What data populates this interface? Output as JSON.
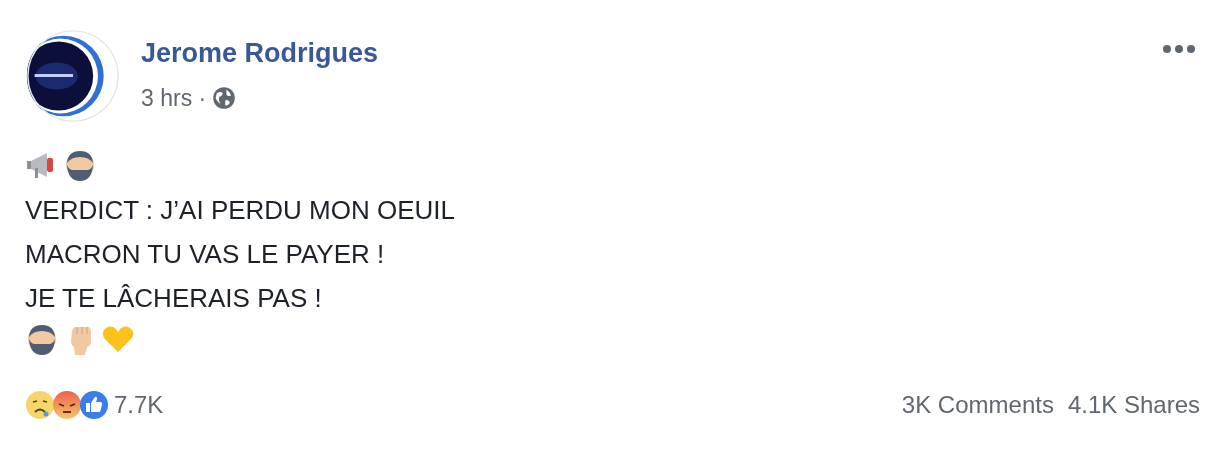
{
  "post": {
    "author": "Jerome Rodrigues",
    "time": "3 hrs ·",
    "lines": [
      "VERDICT : J’AI PERDU MON OEUIL",
      "MACRON TU VAS LE PAYER !",
      "JE TE LÂCHERAIS PAS !"
    ],
    "reactions_count": "7.7K",
    "comments": "3K Comments",
    "shares": "4.1K Shares"
  }
}
